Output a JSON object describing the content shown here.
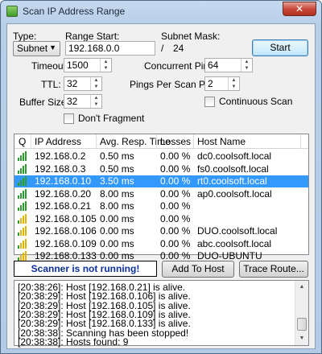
{
  "window": {
    "title": "Scan IP Address Range",
    "close_glyph": "✕"
  },
  "form": {
    "type_label": "Type:",
    "type_value": "Subnet",
    "range_start_label": "Range Start:",
    "range_start_value": "192.168.0.0",
    "subnet_mask_label": "Subnet Mask:",
    "slash": "/",
    "subnet_mask_value": "24",
    "start_button": "Start",
    "timeout_label": "Timeout:",
    "timeout_value": "1500",
    "ttl_label": "TTL:",
    "ttl_value": "32",
    "buffer_label": "Buffer Size:",
    "buffer_value": "32",
    "concurrent_label": "Concurrent Pings:",
    "concurrent_value": "64",
    "ppsp_label": "Pings Per Scan Pass:",
    "ppsp_value": "2",
    "continuous_label": "Continuous Scan",
    "dont_fragment_label": "Don't Fragment"
  },
  "table": {
    "columns": [
      "Q",
      "IP Address",
      "Avg. Resp. Time",
      "Losses",
      "Host Name"
    ],
    "rows": [
      {
        "ip": "192.168.0.2",
        "time": "0.50 ms",
        "loss": "0.00 %",
        "host": "dc0.coolsoft.local",
        "selected": false
      },
      {
        "ip": "192.168.0.3",
        "time": "0.50 ms",
        "loss": "0.00 %",
        "host": "fs0.coolsoft.local",
        "selected": false
      },
      {
        "ip": "192.168.0.10",
        "time": "3.50 ms",
        "loss": "0.00 %",
        "host": "rt0.coolsoft.local",
        "selected": true
      },
      {
        "ip": "192.168.0.20",
        "time": "8.00 ms",
        "loss": "0.00 %",
        "host": "ap0.coolsoft.local",
        "selected": false
      },
      {
        "ip": "192.168.0.21",
        "time": "8.00 ms",
        "loss": "0.00 %",
        "host": "",
        "selected": false
      },
      {
        "ip": "192.168.0.105",
        "time": "0.00 ms",
        "loss": "0.00 %",
        "host": "",
        "selected": false
      },
      {
        "ip": "192.168.0.106",
        "time": "0.00 ms",
        "loss": "0.00 %",
        "host": "DUO.coolsoft.local",
        "selected": false
      },
      {
        "ip": "192.168.0.109",
        "time": "0.00 ms",
        "loss": "0.00 %",
        "host": "abc.coolsoft.local",
        "selected": false
      },
      {
        "ip": "192.168.0.133",
        "time": "0.00 ms",
        "loss": "0.00 %",
        "host": "DUO-UBUNTU",
        "selected": false
      }
    ]
  },
  "status": {
    "text": "Scanner is not running!",
    "add_host_button": "Add To Host List...",
    "trace_button": "Trace Route..."
  },
  "log": {
    "lines": [
      "[20:38:26]: Host [192.168.0.21] is alive.",
      "[20:38:29]: Host [192.168.0.106] is alive.",
      "[20:38:29]: Host [192.168.0.105] is alive.",
      "[20:38:29]: Host [192.168.0.109] is alive.",
      "[20:38:29]: Host [192.168.0.133] is alive.",
      "[20:38:38]: Scanning has been stopped!",
      "[20:38:38]: Hosts found: 9"
    ]
  },
  "colors": {
    "selection": "#3399ff",
    "signal_green": "#2e9b2e",
    "signal_yellow": "#e0b400",
    "status_text": "#0b2f9c"
  }
}
